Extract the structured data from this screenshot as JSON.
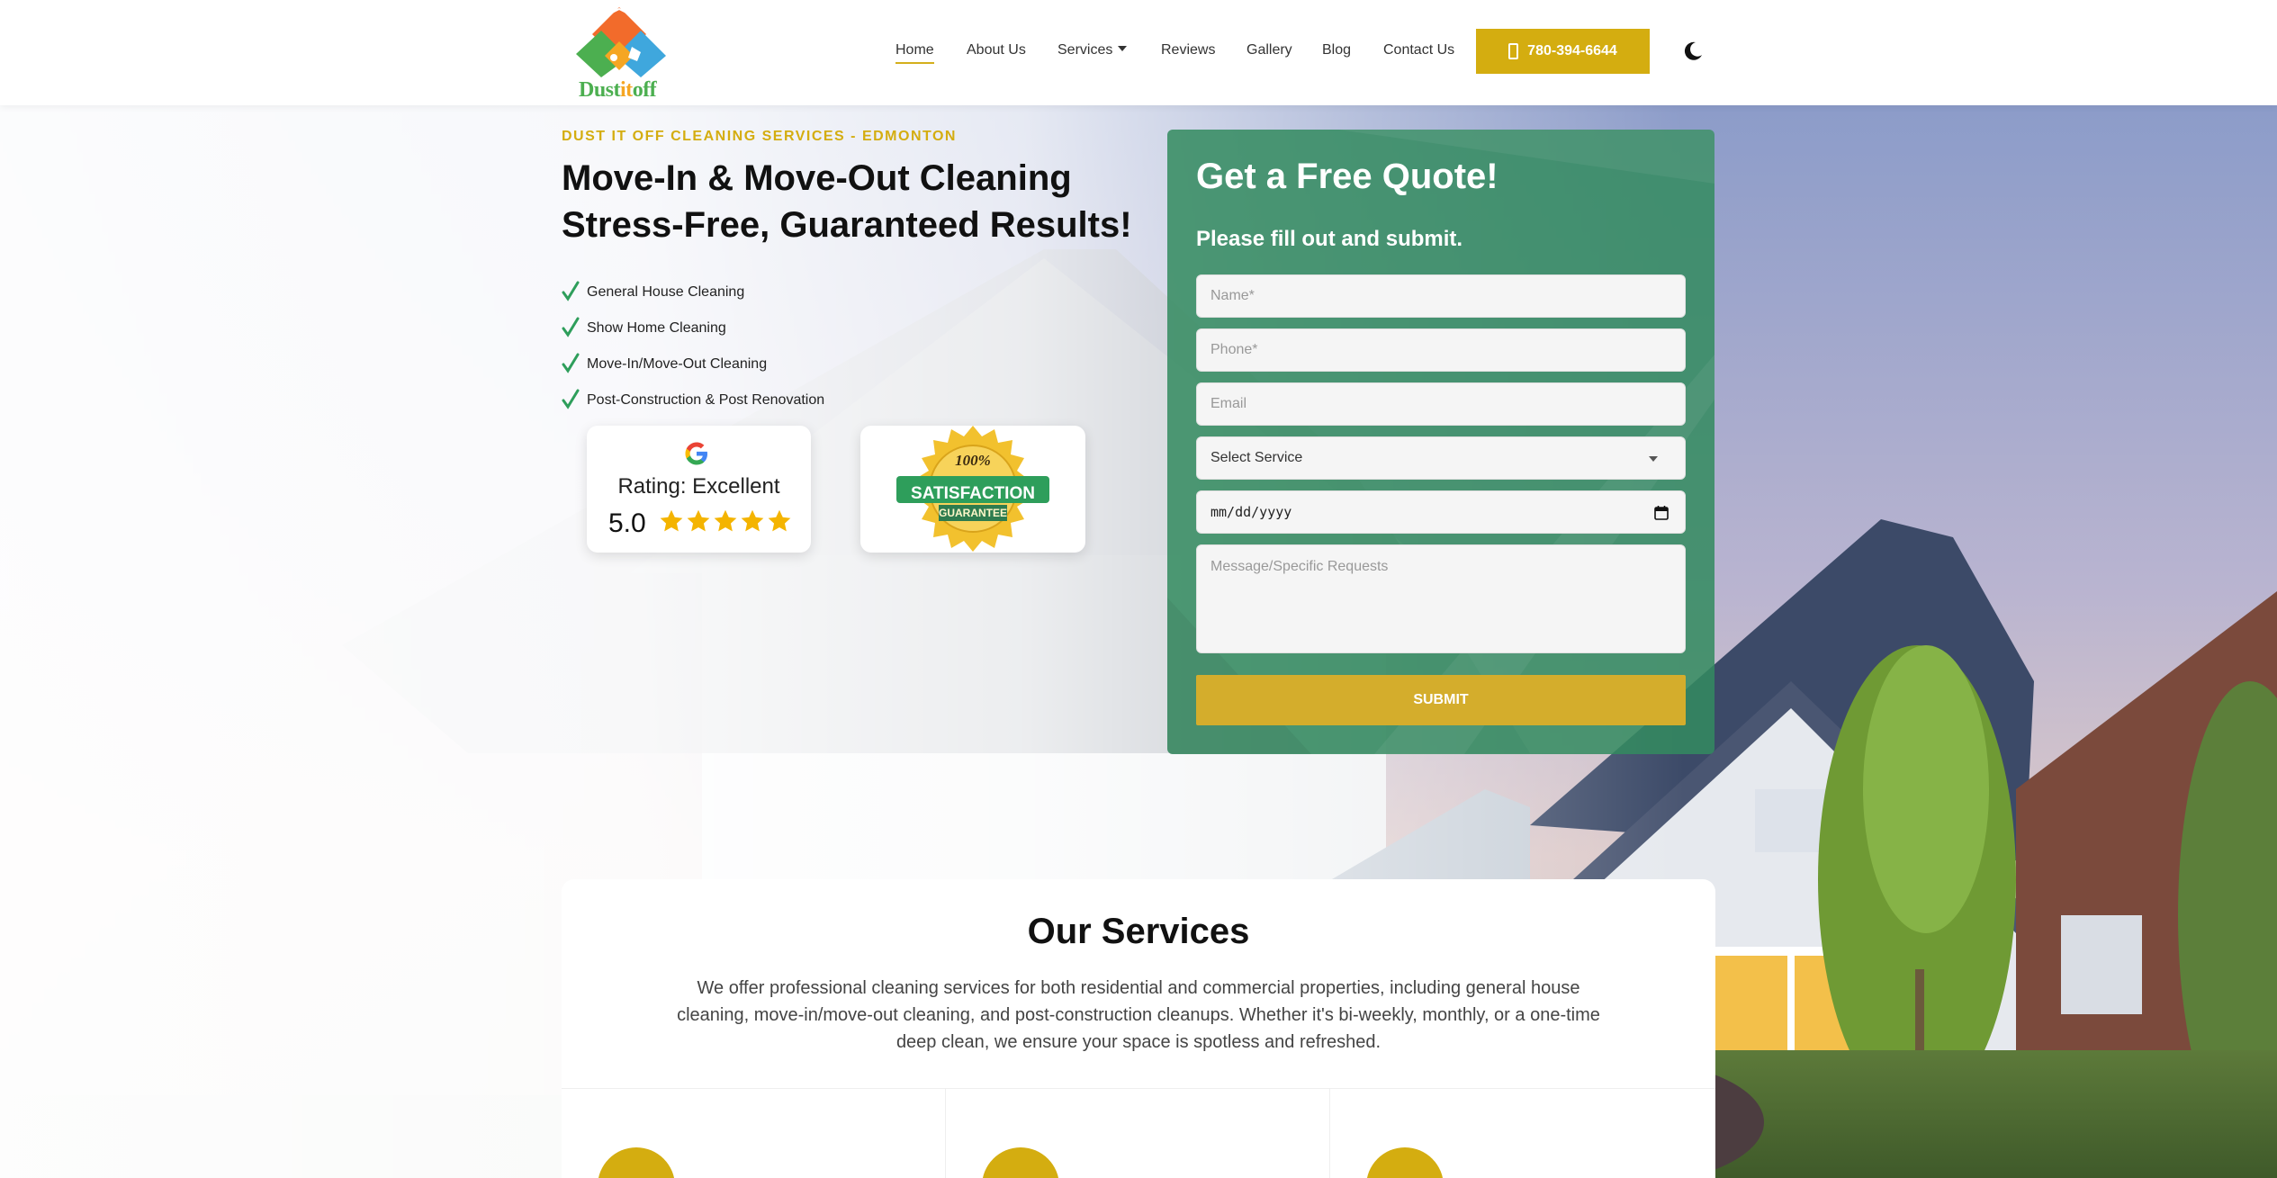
{
  "header": {
    "logo_text_a": "Dust",
    "logo_text_b": "it",
    "logo_text_c": "off",
    "nav": [
      {
        "label": "Home"
      },
      {
        "label": "About Us"
      },
      {
        "label": "Services"
      },
      {
        "label": "Reviews"
      },
      {
        "label": "Gallery"
      },
      {
        "label": "Blog"
      },
      {
        "label": "Contact Us"
      }
    ],
    "phone": "780-394-6644"
  },
  "hero": {
    "eyebrow": "DUST IT OFF CLEANING SERVICES - EDMONTON",
    "headline_1": "Move-In & Move-Out Cleaning",
    "headline_2": "Stress-Free, Guaranteed Results!",
    "features": [
      "General House Cleaning",
      "Show Home Cleaning",
      "Move-In/Move-Out Cleaning",
      "Post-Construction & Post Renovation"
    ],
    "rating_label": "Rating: Excellent",
    "rating_value": "5.0",
    "rating_stars": 5,
    "seal": {
      "top": "100%",
      "middle": "SATISFACTION",
      "bottom": "GUARANTEE"
    }
  },
  "quote_form": {
    "title": "Get a Free Quote!",
    "subtitle": "Please fill out and submit.",
    "name_placeholder": "Name*",
    "phone_placeholder": "Phone*",
    "email_placeholder": "Email",
    "service_selected": "Select Service",
    "date_placeholder": "mm/dd/yyyy",
    "message_placeholder": "Message/Specific Requests",
    "submit_label": "SUBMIT"
  },
  "services": {
    "title": "Our Services",
    "description": "We offer professional cleaning services for both residential and commercial properties, including general house cleaning, move-in/move-out cleaning, and post-construction cleanups. Whether it's bi-weekly, monthly, or a one-time deep clean, we ensure your space is spotless and refreshed."
  },
  "colors": {
    "accent_gold": "#d4ad10",
    "form_green": "#338a60",
    "check_green": "#2e9e5b"
  }
}
